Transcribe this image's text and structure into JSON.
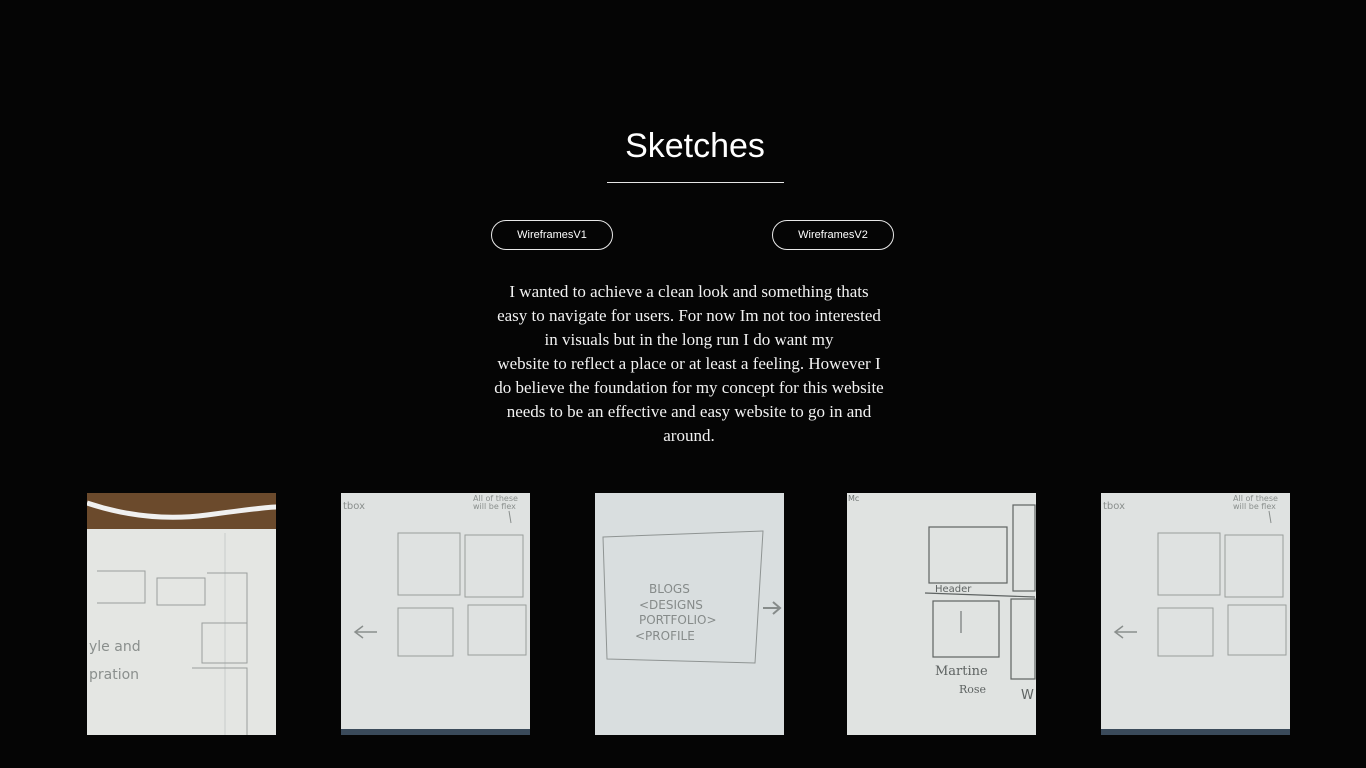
{
  "section": {
    "title": "Sketches"
  },
  "buttons": [
    {
      "label": "WireframesV1"
    },
    {
      "label": "WireframesV2"
    }
  ],
  "description": {
    "lines": [
      "I wanted to achieve a clean look and something thats",
      "easy to navigate for users. For now Im not too interested",
      "in visuals but in the long run I do want my",
      "website to reflect a place or at least a feeling. However I",
      "do believe the foundation for my concept for this website",
      "needs to be an effective and easy website to go in and",
      "around."
    ]
  },
  "gallery": {
    "images": [
      {
        "annotations": [
          "yle and",
          "pration"
        ]
      },
      {
        "annotations": [
          "tbox",
          "All of these",
          "will be flex"
        ]
      },
      {
        "annotations": [
          "BLOGS",
          "<DESIGNS",
          "PORTFOLIO>",
          "<PROFILE"
        ]
      },
      {
        "annotations": [
          "Mc",
          "Header",
          "Martine",
          "Rose",
          "W"
        ]
      },
      {
        "annotations": [
          "tbox",
          "All of these",
          "will be flex"
        ]
      }
    ]
  },
  "colors": {
    "background": "#050505",
    "text": "#ffffff",
    "paper": "#dcdfdd",
    "pencil": "#8a8f8d"
  }
}
